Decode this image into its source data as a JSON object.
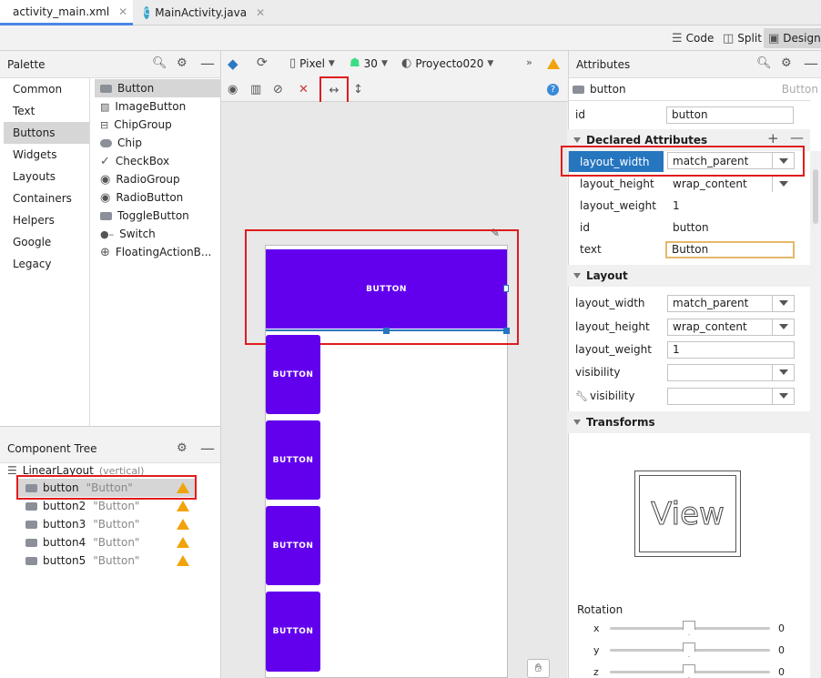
{
  "tabs": [
    {
      "label": "activity_main.xml",
      "active": true
    },
    {
      "label": "MainActivity.java",
      "active": false
    }
  ],
  "view_modes": {
    "code": "Code",
    "split": "Split",
    "design": "Design"
  },
  "palette": {
    "title": "Palette",
    "categories": [
      "Common",
      "Text",
      "Buttons",
      "Widgets",
      "Layouts",
      "Containers",
      "Helpers",
      "Google",
      "Legacy"
    ],
    "selected_category": "Buttons",
    "items": [
      "Button",
      "ImageButton",
      "ChipGroup",
      "Chip",
      "CheckBox",
      "RadioGroup",
      "RadioButton",
      "ToggleButton",
      "Switch",
      "FloatingActionB..."
    ]
  },
  "toolbar": {
    "device": "Pixel",
    "api": "30",
    "theme": "Proyecto020"
  },
  "component_tree": {
    "title": "Component Tree",
    "root": {
      "name": "LinearLayout",
      "hint": "(vertical)"
    },
    "children": [
      {
        "name": "button",
        "text": "\"Button\""
      },
      {
        "name": "button2",
        "text": "\"Button\""
      },
      {
        "name": "button3",
        "text": "\"Button\""
      },
      {
        "name": "button4",
        "text": "\"Button\""
      },
      {
        "name": "button5",
        "text": "\"Button\""
      }
    ]
  },
  "canvas": {
    "buttons": [
      "BUTTON",
      "BUTTON",
      "BUTTON",
      "BUTTON",
      "BUTTON"
    ]
  },
  "attributes": {
    "title": "Attributes",
    "component": "button",
    "component_type": "Button",
    "id_label": "id",
    "id_value": "button",
    "declared_title": "Declared Attributes",
    "declared": [
      {
        "key": "layout_width",
        "value": "match_parent"
      },
      {
        "key": "layout_height",
        "value": "wrap_content"
      },
      {
        "key": "layout_weight",
        "value": "1"
      },
      {
        "key": "id",
        "value": "button"
      },
      {
        "key": "text",
        "value": "Button"
      }
    ],
    "layout_title": "Layout",
    "layout": [
      {
        "key": "layout_width",
        "value": "match_parent"
      },
      {
        "key": "layout_height",
        "value": "wrap_content"
      },
      {
        "key": "layout_weight",
        "value": "1"
      },
      {
        "key": "visibility",
        "value": ""
      },
      {
        "key": "visibility",
        "value": ""
      }
    ],
    "transforms_title": "Transforms",
    "preview_text": "View",
    "rotation_title": "Rotation",
    "rotation": [
      {
        "axis": "x",
        "value": "0"
      },
      {
        "axis": "y",
        "value": "0"
      },
      {
        "axis": "z",
        "value": "0"
      }
    ]
  },
  "colors": {
    "accent": "#6200ee",
    "highlight": "#e01c1c",
    "selection": "#2675bf"
  }
}
